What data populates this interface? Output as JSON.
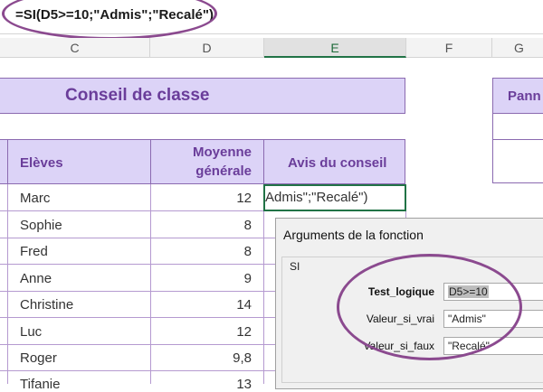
{
  "formula_bar": {
    "text": "=SI(D5>=10;\"Admis\";\"Recalé\")"
  },
  "columns": [
    "C",
    "D",
    "E",
    "F",
    "G"
  ],
  "selected_column": "E",
  "sheet": {
    "title": "Conseil de classe",
    "side_panel_title": "Pann",
    "headers": {
      "eleves": "Elèves",
      "moyenne_line1": "Moyenne",
      "moyenne_line2": "générale",
      "avis": "Avis du conseil"
    },
    "active_cell_text": "Admis\";\"Recalé\")",
    "rows": [
      {
        "name": "Marc",
        "avg": "12"
      },
      {
        "name": "Sophie",
        "avg": "8"
      },
      {
        "name": "Fred",
        "avg": "8"
      },
      {
        "name": "Anne",
        "avg": "9"
      },
      {
        "name": "Christine",
        "avg": "14"
      },
      {
        "name": "Luc",
        "avg": "12"
      },
      {
        "name": "Roger",
        "avg": "9,8"
      },
      {
        "name": "Tifanie",
        "avg": "13"
      }
    ]
  },
  "dialog": {
    "title": "Arguments de la fonction",
    "function_name": "SI",
    "args": [
      {
        "label": "Test_logique",
        "value": "D5>=10"
      },
      {
        "label": "Valeur_si_vrai",
        "value": "\"Admis\""
      },
      {
        "label": "Valeur_si_faux",
        "value": "\"Recalé\""
      }
    ]
  },
  "colors": {
    "accent_purple": "#6a3d9a",
    "band_fill": "#dcd3f7",
    "annotation": "#8b4a8f",
    "excel_green": "#217346"
  }
}
